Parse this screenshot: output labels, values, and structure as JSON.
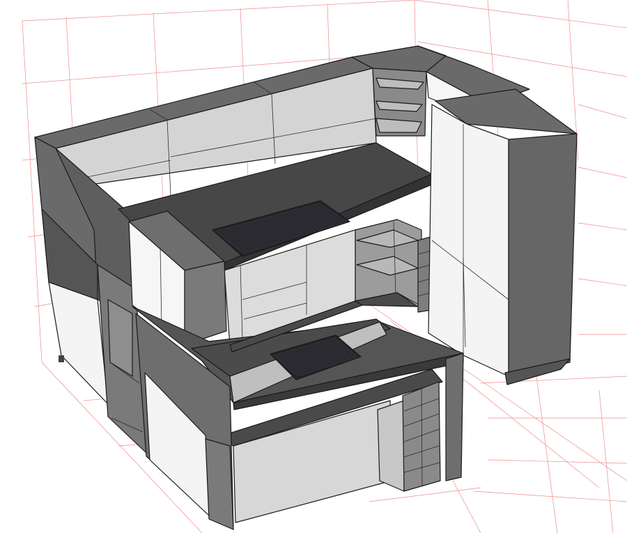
{
  "view": {
    "kind": "3D kitchen design viewport",
    "projection": "isometric-perspective",
    "background_color": "#ffffff",
    "grid_color": "#f08a8a"
  },
  "colors": {
    "carcass_dark": "#5b5b5b",
    "carcass_side": "#6e6e6e",
    "countertop": "#4a4a4a",
    "front_light": "#d9d9d9",
    "front_white": "#f7f7f7",
    "cooktop": "#222222",
    "edge": "#1a1a1a"
  },
  "objects": [
    "back-upper-cabinets",
    "left-upper-cabinets",
    "corner-open-shelves",
    "back-countertop",
    "back-cooktop",
    "back-base-cabinets",
    "corner-base-shelves",
    "tall-pantry-cabinet",
    "hanging-wall-cabinet",
    "peninsula-island",
    "island-cooktop",
    "wine-rack",
    "left-tall-cabinet"
  ]
}
